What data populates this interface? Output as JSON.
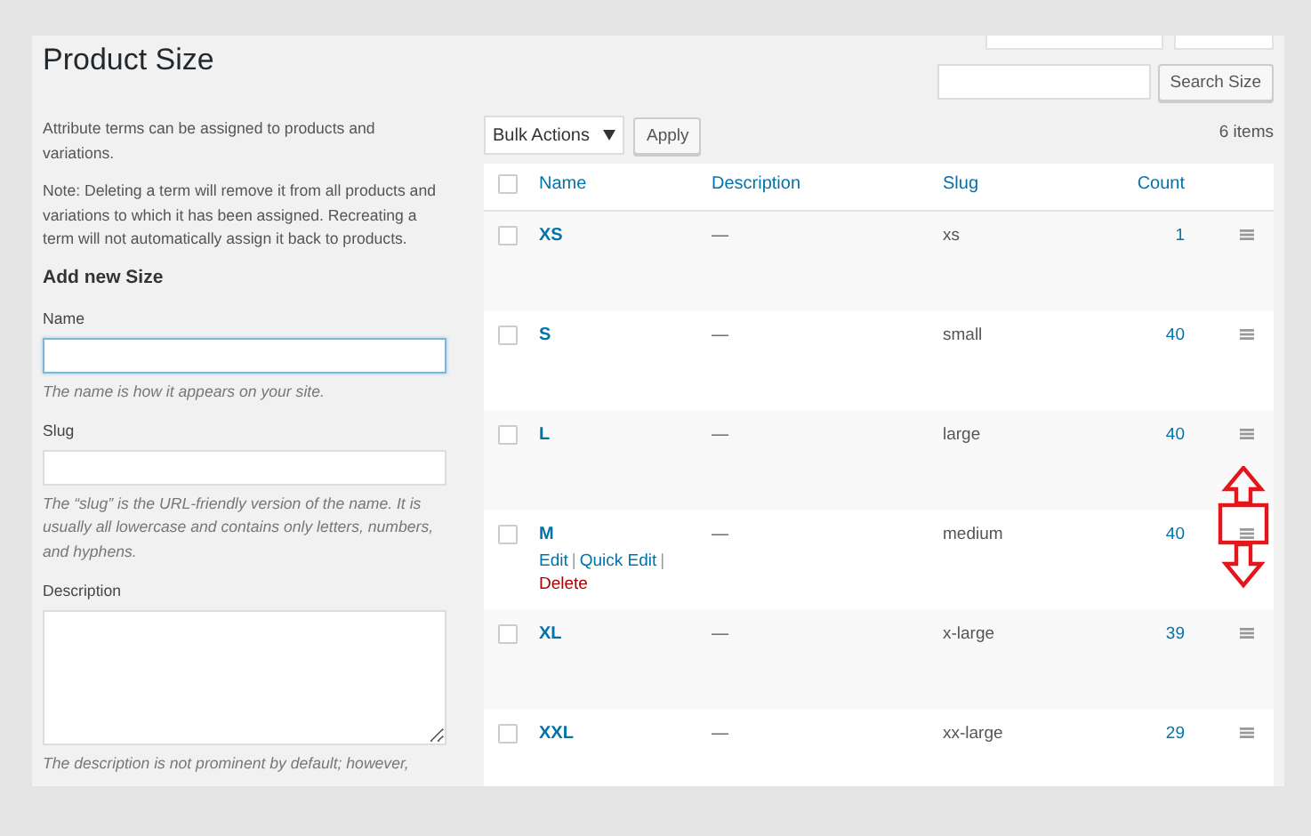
{
  "header": {
    "title": "Product Size"
  },
  "form": {
    "intro": "Attribute terms can be assigned to products and variations.",
    "note": "Note: Deleting a term will remove it from all products and variations to which it has been assigned. Recreating a term will not automatically assign it back to products.",
    "heading": "Add new Size",
    "fields": [
      {
        "kind": "input",
        "label": "Name",
        "focused": true,
        "hint": "The name is how it appears on your site."
      },
      {
        "kind": "input",
        "label": "Slug",
        "focused": false,
        "hint": "The “slug” is the URL-friendly version of the name. It is usually all lowercase and contains only letters, numbers, and hyphens."
      },
      {
        "kind": "textarea",
        "label": "Description",
        "focused": false,
        "hint": "The description is not prominent by default; however,"
      }
    ]
  },
  "search": {
    "button": "Search Size"
  },
  "bulk": {
    "select": "Bulk Actions",
    "apply": "Apply",
    "count": "6 items"
  },
  "table": {
    "select_all_checked": false,
    "columns": [
      "Name",
      "Description",
      "Slug",
      "Count"
    ],
    "rows": [
      {
        "name": "XS",
        "description": "—",
        "slug": "xs",
        "count": "1",
        "checked": false
      },
      {
        "name": "S",
        "description": "—",
        "slug": "small",
        "count": "40",
        "checked": false
      },
      {
        "name": "L",
        "description": "—",
        "slug": "large",
        "count": "40",
        "checked": false
      },
      {
        "name": "M",
        "description": "—",
        "slug": "medium",
        "count": "40",
        "checked": false,
        "annotated": true,
        "actions": [
          {
            "kind": "link",
            "label": "Edit",
            "separator": "|"
          },
          {
            "kind": "link",
            "label": "Quick Edit",
            "separator": "|"
          },
          {
            "kind": "delete",
            "label": "Delete"
          }
        ]
      },
      {
        "name": "XL",
        "description": "—",
        "slug": "x-large",
        "count": "39",
        "checked": false
      },
      {
        "name": "XXL",
        "description": "—",
        "slug": "xx-large",
        "count": "29",
        "checked": false
      }
    ]
  }
}
